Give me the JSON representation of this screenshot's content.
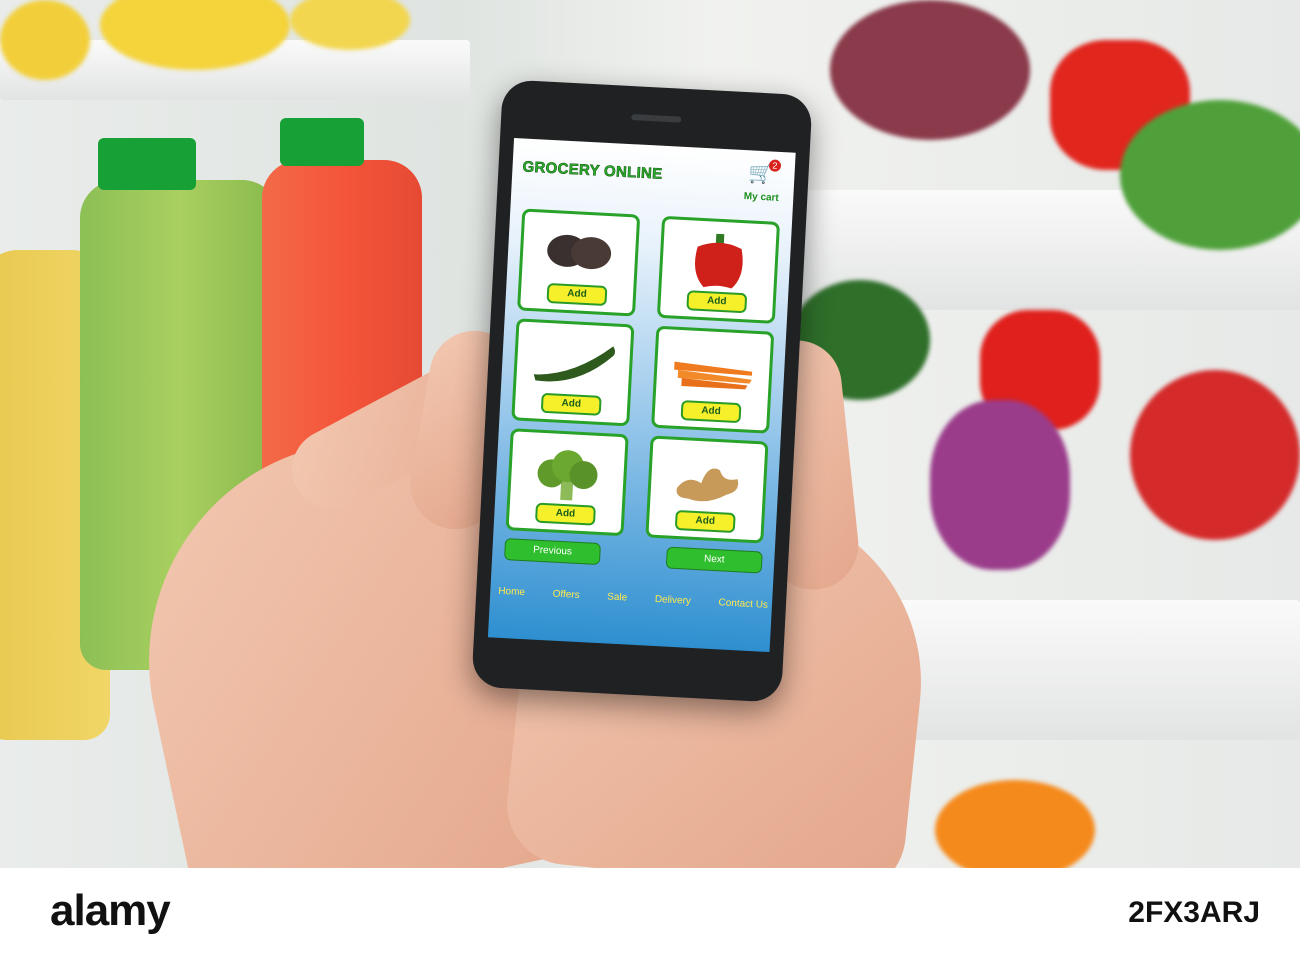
{
  "app": {
    "title": "GROCERY ONLINE",
    "cart": {
      "label": "My cart",
      "count": "2",
      "icon": "cart-icon"
    }
  },
  "products": [
    {
      "name": "avocado",
      "button": "Add",
      "color": "#3b3030"
    },
    {
      "name": "red-pepper",
      "button": "Add",
      "color": "#d0201a"
    },
    {
      "name": "cucumber",
      "button": "Add",
      "color": "#2f5a1e"
    },
    {
      "name": "carrots",
      "button": "Add",
      "color": "#f07a1e"
    },
    {
      "name": "broccoli",
      "button": "Add",
      "color": "#5f9a2a"
    },
    {
      "name": "ginger",
      "button": "Add",
      "color": "#c89a5a"
    }
  ],
  "pager": {
    "previous": "Previous",
    "next": "Next"
  },
  "nav": [
    "Home",
    "Offers",
    "Sale",
    "Delivery",
    "Contact Us"
  ],
  "watermark": {
    "logo": "alamy",
    "code": "2FX3ARJ"
  },
  "colors": {
    "accent": "#29a229",
    "button": "#f5f02a",
    "nav_text": "#ffe94d"
  }
}
